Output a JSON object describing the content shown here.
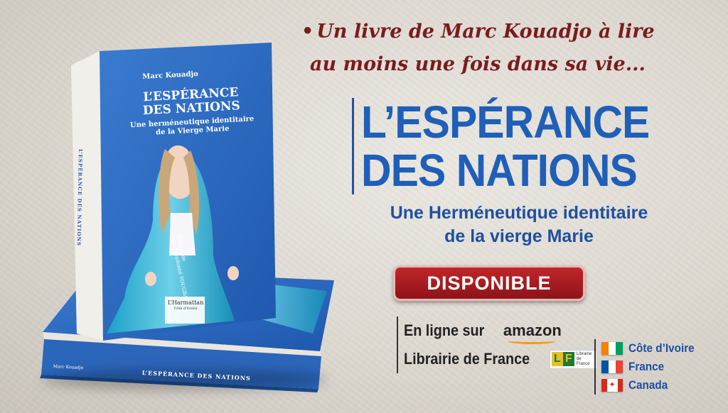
{
  "tagline": {
    "line1": "Un livre de Marc Kouadjo à lire",
    "line2": "au moins une fois dans sa vie..."
  },
  "title": {
    "line1": "L’ESPÉRANCE",
    "line2": "DES NATIONS",
    "subtitle_line1": "Une Herméneutique identitaire",
    "subtitle_line2": "de la vierge Marie"
  },
  "badge": {
    "label": "DISPONIBLE"
  },
  "availability": {
    "online_label": "En ligne sur",
    "amazon_label": "amazon",
    "bookstore_label": "Librairie de France",
    "lf_logo_letters": [
      "L",
      "F"
    ],
    "lf_logo_text": "Librairie de France"
  },
  "countries": [
    {
      "name": "Côte d’Ivoire",
      "flag": [
        "#f77f00",
        "#ffffff",
        "#009e60"
      ]
    },
    {
      "name": "France",
      "flag": [
        "#0055a4",
        "#ffffff",
        "#ef4135"
      ]
    },
    {
      "name": "Canada",
      "flag": [
        "#d52b1e",
        "#ffffff",
        "#d52b1e"
      ]
    }
  ],
  "book": {
    "author": "Marc Kouadjo",
    "cover_title_line1": "L’ESPÉRANCE",
    "cover_title_line2": "DES NATIONS",
    "cover_subtitle_line1": "Une herméneutique identitaire",
    "cover_subtitle_line2": "de la Vierge Marie",
    "preface_label": "Préface de",
    "preface_name": "Mgr Dieudonné YOUGBARÉ",
    "publisher": "L’Harmattan",
    "publisher_sub": "Côte d’Ivoire",
    "spine_title": "L’ESPÉRANCE DES NATIONS",
    "spine_author": "Marc Kouadjo",
    "cover_color": "#2c6ac0"
  },
  "colors": {
    "tagline": "#7a1c1c",
    "title": "#1f5fb8",
    "badge": "#a81c22"
  }
}
